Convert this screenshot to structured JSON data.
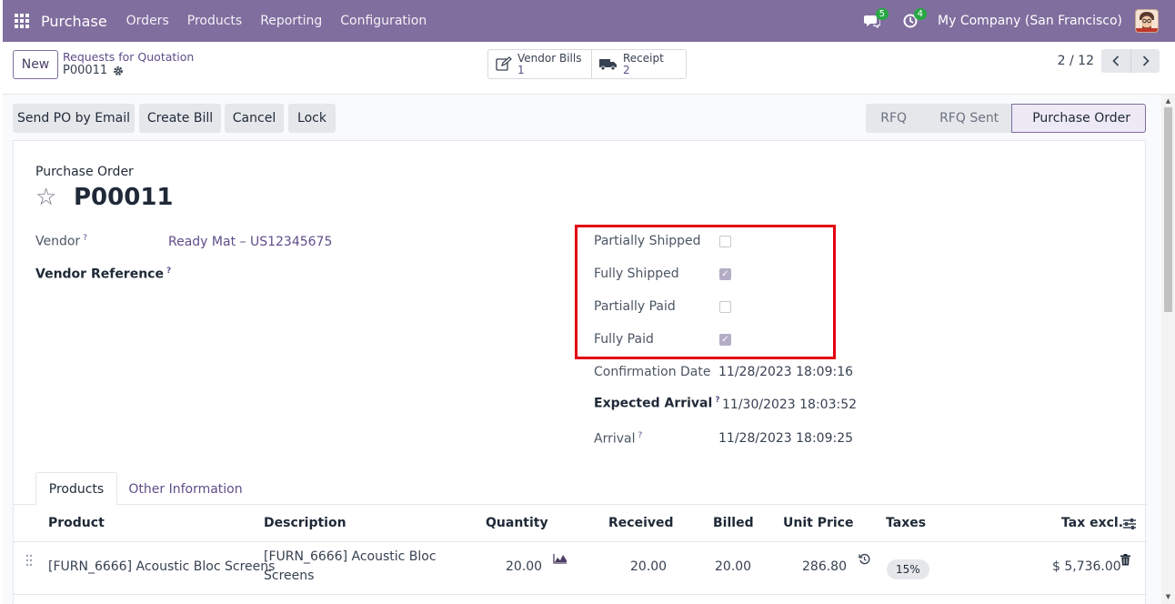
{
  "navbar": {
    "app_name": "Purchase",
    "menu": [
      "Orders",
      "Products",
      "Reporting",
      "Configuration"
    ],
    "messages_count": "5",
    "activities_count": "4",
    "company": "My Company (San Francisco)",
    "icons": {
      "apps": "apps-grid-icon",
      "messages": "chat-icon",
      "activities": "clock-icon",
      "avatar": "user-avatar"
    }
  },
  "control": {
    "new_label": "New",
    "breadcrumb": "Requests for Quotation",
    "record": "P00011",
    "smart_buttons": [
      {
        "label": "Vendor Bills",
        "count": "1"
      },
      {
        "label": "Receipt",
        "count": "2"
      }
    ],
    "pager": "2 / 12"
  },
  "actions": [
    "Send PO by Email",
    "Create Bill",
    "Cancel",
    "Lock"
  ],
  "stages": {
    "items": [
      "RFQ",
      "RFQ Sent",
      "Purchase Order"
    ],
    "active": "Purchase Order"
  },
  "form": {
    "doc_type": "Purchase Order",
    "name": "P00011",
    "vendor_label": "Vendor",
    "vendor_help": "?",
    "vendor_value": "Ready Mat – US12345675",
    "vendor_ref_label": "Vendor Reference",
    "vendor_ref_help": "?",
    "flags": [
      {
        "label": "Partially Shipped",
        "checked": false
      },
      {
        "label": "Fully Shipped",
        "checked": true
      },
      {
        "label": "Partially Paid",
        "checked": false
      },
      {
        "label": "Fully Paid",
        "checked": true
      }
    ],
    "confirmation_label": "Confirmation Date",
    "confirmation_value": "11/28/2023 18:09:16",
    "expected_label": "Expected Arrival",
    "expected_help": "?",
    "expected_value": "11/30/2023 18:03:52",
    "arrival_label": "Arrival",
    "arrival_help": "?",
    "arrival_value": "11/28/2023 18:09:25"
  },
  "tabs": [
    "Products",
    "Other Information"
  ],
  "table": {
    "columns": [
      "Product",
      "Description",
      "Quantity",
      "Received",
      "Billed",
      "Unit Price",
      "Taxes",
      "Tax excl."
    ],
    "rows": [
      {
        "product": "[FURN_6666] Acoustic Bloc Screens",
        "description_1": "[FURN_6666] Acoustic Bloc",
        "description_2": "Screens",
        "quantity": "20.00",
        "received": "20.00",
        "billed": "20.00",
        "unit_price": "286.80",
        "tax": "15%",
        "subtotal": "$ 5,736.00"
      }
    ]
  }
}
